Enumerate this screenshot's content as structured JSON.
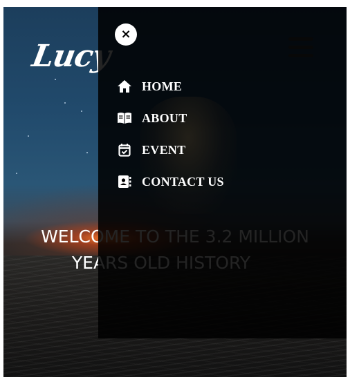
{
  "brand": {
    "logo_text": "Lucy"
  },
  "hero": {
    "headline_line1": "WELCOME TO THE 3.2 MILLION",
    "headline_line2": "YEARS OLD HISTORY"
  },
  "menu": {
    "close_symbol": "×",
    "items": [
      {
        "label": "HOME",
        "icon": "home-icon"
      },
      {
        "label": "ABOUT",
        "icon": "book-open-icon"
      },
      {
        "label": "EVENT",
        "icon": "calendar-check-icon"
      },
      {
        "label": "CONTACT US",
        "icon": "address-book-icon"
      }
    ]
  },
  "colors": {
    "overlay": "#000000",
    "text": "#ffffff",
    "sky": "#214a6c",
    "sunset": "#ff7828"
  }
}
